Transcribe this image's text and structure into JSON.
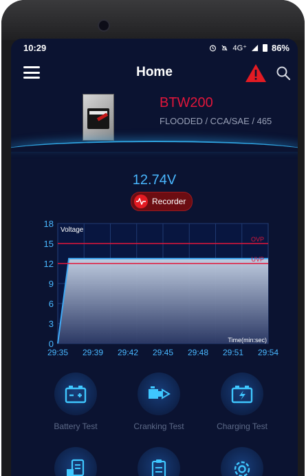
{
  "status_bar": {
    "time": "10:29",
    "network": "4G⁺",
    "battery_percent": "86%"
  },
  "header": {
    "title": "Home",
    "icons": [
      "menu-icon",
      "warning-icon",
      "search-icon"
    ]
  },
  "battery": {
    "model": "BTW200",
    "specs": "FLOODED / CCA/SAE / 465"
  },
  "reading": {
    "voltage": "12.74V",
    "recorder_label": "Recorder"
  },
  "chart_data": {
    "type": "area",
    "title": "Voltage",
    "xlabel": "Time(min:sec)",
    "x_ticks": [
      "29:35",
      "29:39",
      "29:42",
      "29:45",
      "29:48",
      "29:51",
      "29:54"
    ],
    "y_ticks": [
      0,
      3,
      6,
      9,
      12,
      15,
      18
    ],
    "ylim": [
      0,
      18
    ],
    "series": [
      {
        "values": [
          0.0,
          12.74,
          12.74,
          12.74,
          12.74,
          12.74,
          12.74,
          12.74
        ],
        "x": [
          "29:35",
          "29:36",
          "29:39",
          "29:42",
          "29:45",
          "29:48",
          "29:51",
          "29:54"
        ]
      }
    ],
    "reference_lines": [
      {
        "label": "OVP",
        "value": 15,
        "color": "#e0173a"
      },
      {
        "label": "UVP",
        "value": 12,
        "color": "#e0173a"
      }
    ],
    "grid": true,
    "colors": {
      "line": "#3fa9f5",
      "fill_top": "#c9d6e8",
      "fill_bottom": "#2d3a66"
    }
  },
  "menu": [
    {
      "label": "Battery Test",
      "icon": "battery-test-icon"
    },
    {
      "label": "Cranking Test",
      "icon": "cranking-test-icon"
    },
    {
      "label": "Charging Test",
      "icon": "charging-test-icon"
    },
    {
      "label": "",
      "icon": "report-icon"
    },
    {
      "label": "",
      "icon": "clipboard-icon"
    },
    {
      "label": "",
      "icon": "settings-icon"
    }
  ],
  "colors": {
    "background": "#0b1331",
    "accent_red": "#e1163b",
    "accent_blue": "#49b7ff"
  }
}
